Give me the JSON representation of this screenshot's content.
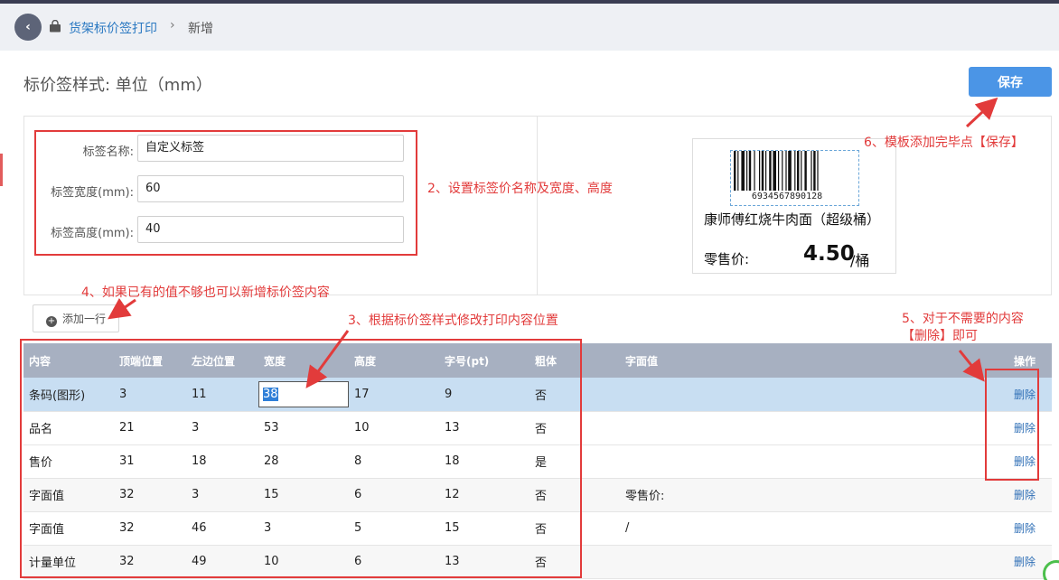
{
  "breadcrumb": {
    "back": "‹",
    "section": "货架标价签打印",
    "sep": "›",
    "current": "新增"
  },
  "page": {
    "title": "标价签样式: 单位（mm）",
    "save_label": "保存"
  },
  "form": {
    "name_label": "标签名称:",
    "name_value": "自定义标签",
    "width_label": "标签宽度(mm):",
    "width_value": "60",
    "height_label": "标签高度(mm):",
    "height_value": "40"
  },
  "preview": {
    "barcode_number": "6934567890128",
    "product_name": "康师傅红烧牛肉面（超级桶）",
    "price_label": "零售价:",
    "price": "4.50",
    "unit": "/桶"
  },
  "annotations": {
    "a2": "2、设置标签价名称及宽度、高度",
    "a3": "3、根据标价签样式修改打印内容位置",
    "a4": "4、如果已有的值不够也可以新增标价签内容",
    "a5_line1": "5、对于不需要的内容",
    "a5_line2": "【删除】即可",
    "a6": "6、模板添加完毕点【保存】"
  },
  "add_row_label": "添加一行",
  "table": {
    "headers": [
      "内容",
      "顶端位置",
      "左边位置",
      "宽度",
      "高度",
      "字号(pt)",
      "粗体",
      "字面值",
      "操作"
    ],
    "delete_label": "删除",
    "rows": [
      [
        "条码(图形)",
        "3",
        "11",
        "38",
        "17",
        "9",
        "否",
        ""
      ],
      [
        "品名",
        "21",
        "3",
        "53",
        "10",
        "13",
        "否",
        ""
      ],
      [
        "售价",
        "31",
        "18",
        "28",
        "8",
        "18",
        "是",
        ""
      ],
      [
        "字面值",
        "32",
        "3",
        "15",
        "6",
        "12",
        "否",
        "零售价:"
      ],
      [
        "字面值",
        "32",
        "46",
        "3",
        "5",
        "15",
        "否",
        "/"
      ],
      [
        "计量单位",
        "32",
        "49",
        "10",
        "6",
        "13",
        "否",
        ""
      ]
    ]
  },
  "colors": {
    "accent": "#4b95e6",
    "annotation": "#e23b3b",
    "header": "#a7b0c1",
    "selected_row": "#c8def2"
  }
}
